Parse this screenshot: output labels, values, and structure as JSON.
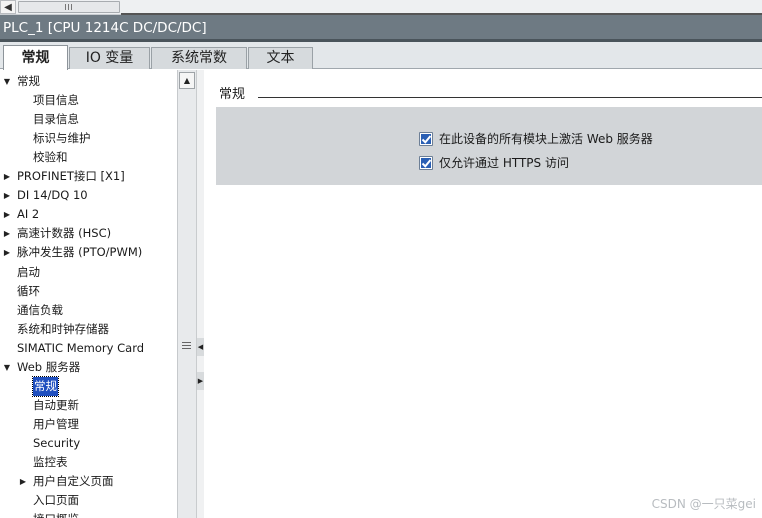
{
  "window": {
    "title": "PLC_1 [CPU 1214C DC/DC/DC]"
  },
  "tabs": [
    {
      "label": "常规",
      "active": true
    },
    {
      "label": "IO 变量",
      "active": false
    },
    {
      "label": "系统常数",
      "active": false
    },
    {
      "label": "文本",
      "active": false
    }
  ],
  "tree": {
    "items": [
      {
        "label": "常规",
        "expander": "expanded"
      },
      {
        "label": "项目信息",
        "expander": "none"
      },
      {
        "label": "目录信息",
        "expander": "none"
      },
      {
        "label": "标识与维护",
        "expander": "none"
      },
      {
        "label": "校验和",
        "expander": "none"
      },
      {
        "label": "PROFINET接口 [X1]",
        "expander": "collapsed"
      },
      {
        "label": "DI 14/DQ 10",
        "expander": "collapsed"
      },
      {
        "label": "AI 2",
        "expander": "collapsed"
      },
      {
        "label": "高速计数器 (HSC)",
        "expander": "collapsed"
      },
      {
        "label": "脉冲发生器 (PTO/PWM)",
        "expander": "collapsed"
      },
      {
        "label": "启动",
        "expander": "none"
      },
      {
        "label": "循环",
        "expander": "none"
      },
      {
        "label": "通信负载",
        "expander": "none"
      },
      {
        "label": "系统和时钟存储器",
        "expander": "none"
      },
      {
        "label": "SIMATIC Memory Card",
        "expander": "none"
      },
      {
        "label": "Web 服务器",
        "expander": "expanded"
      },
      {
        "label": "常规",
        "expander": "none",
        "selected": true
      },
      {
        "label": "自动更新",
        "expander": "none"
      },
      {
        "label": "用户管理",
        "expander": "none"
      },
      {
        "label": "Security",
        "expander": "none"
      },
      {
        "label": "监控表",
        "expander": "none"
      },
      {
        "label": "用户自定义页面",
        "expander": "collapsed"
      },
      {
        "label": "入口页面",
        "expander": "none"
      },
      {
        "label": "接口概览",
        "expander": "none"
      }
    ]
  },
  "content": {
    "section_title": "常规",
    "options": [
      {
        "label": "在此设备的所有模块上激活 Web 服务器",
        "checked": true
      },
      {
        "label": "仅允许通过 HTTPS 访问",
        "checked": true
      }
    ]
  },
  "watermark": "CSDN @一只菜gei",
  "icons": {
    "scroll_left": "chevron-left-icon",
    "scroll_up": "chevron-up-icon",
    "expanded": "triangle-down-icon",
    "collapsed": "triangle-right-icon"
  },
  "colors": {
    "title_bar": "#6e7a83",
    "selection": "#1f4fbf",
    "checkbox": "#2a5fb4"
  }
}
